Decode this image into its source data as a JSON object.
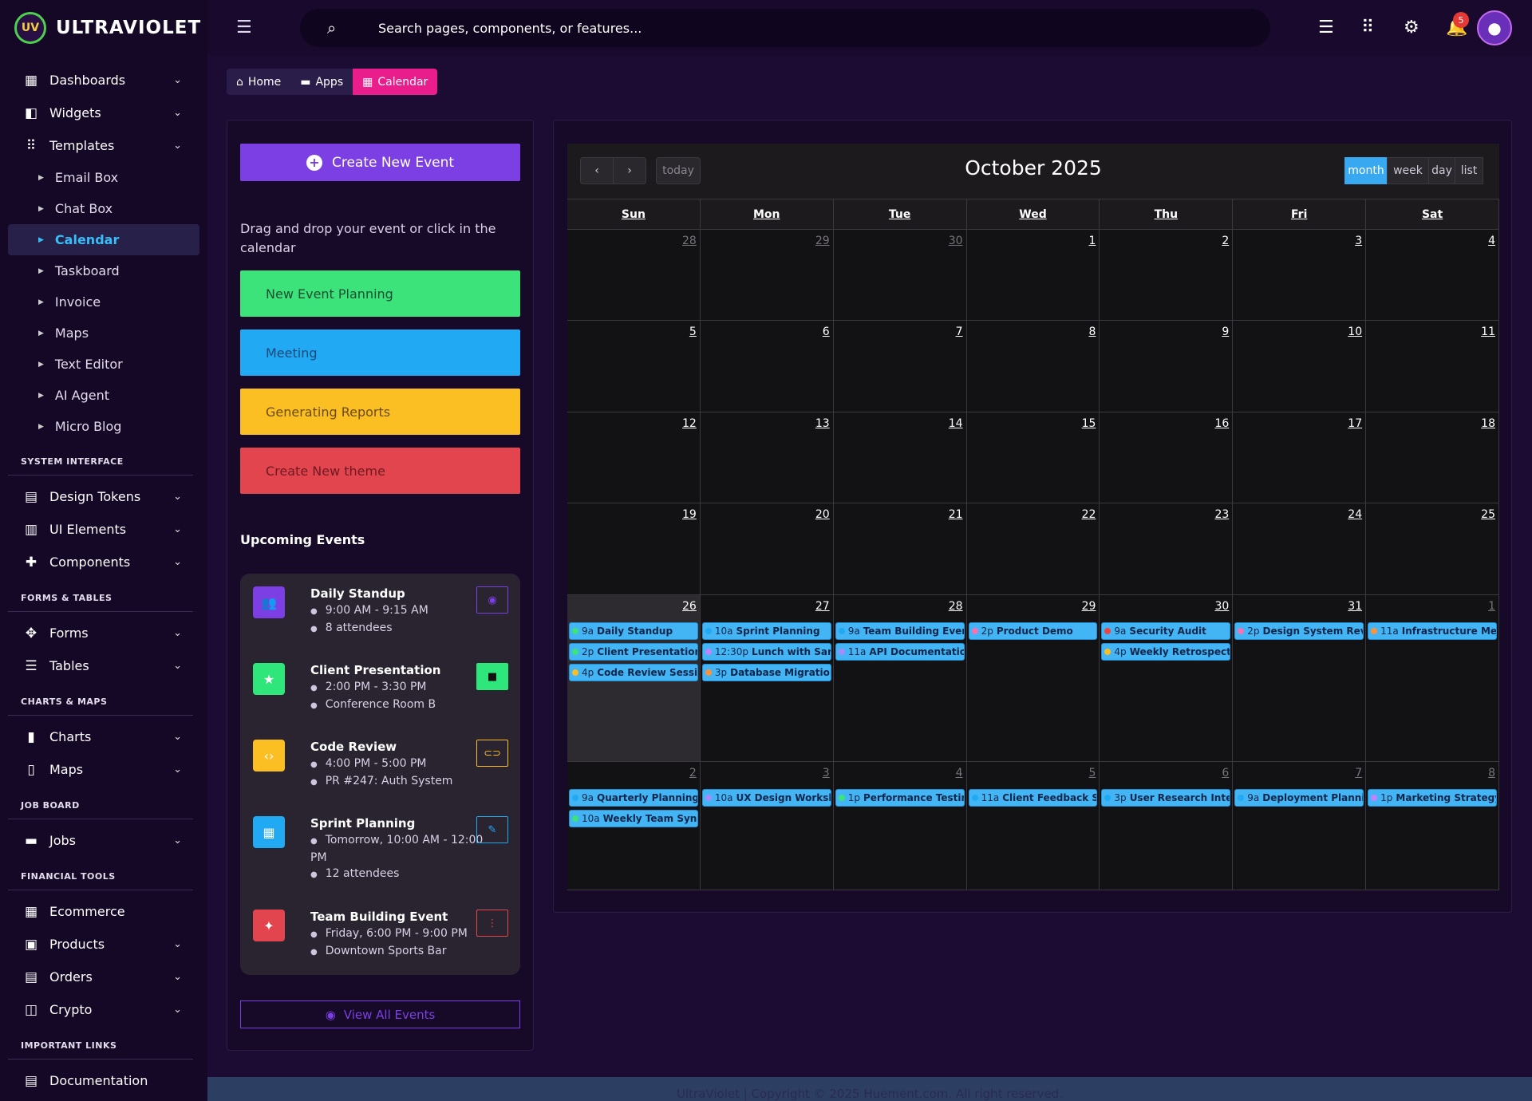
{
  "app": {
    "name": "ULTRAVIOLET",
    "logo_mark": "UV"
  },
  "sidebar": {
    "main": [
      {
        "label": "Dashboards",
        "icon": "dashboard-icon",
        "glyph": "▦",
        "chev": true
      },
      {
        "label": "Widgets",
        "icon": "widgets-icon",
        "glyph": "◧",
        "chev": true
      },
      {
        "label": "Templates",
        "icon": "templates-icon",
        "glyph": "⠿",
        "chev": true
      }
    ],
    "templates": [
      {
        "label": "Email Box"
      },
      {
        "label": "Chat Box"
      },
      {
        "label": "Calendar",
        "active": true
      },
      {
        "label": "Taskboard"
      },
      {
        "label": "Invoice"
      },
      {
        "label": "Maps"
      },
      {
        "label": "Text Editor"
      },
      {
        "label": "AI Agent"
      },
      {
        "label": "Micro Blog"
      }
    ],
    "section_system": "SYSTEM INTERFACE",
    "system": [
      {
        "label": "Design Tokens",
        "glyph": "▤"
      },
      {
        "label": "UI Elements",
        "glyph": "▥"
      },
      {
        "label": "Components",
        "glyph": "✚"
      }
    ],
    "section_forms": "FORMS & TABLES",
    "forms": [
      {
        "label": "Forms",
        "glyph": "✥"
      },
      {
        "label": "Tables",
        "glyph": "☰"
      }
    ],
    "section_charts": "CHARTS & MAPS",
    "charts": [
      {
        "label": "Charts",
        "glyph": "▮"
      },
      {
        "label": "Maps",
        "glyph": "▯"
      }
    ],
    "section_jobs": "JOB BOARD",
    "jobs": [
      {
        "label": "Jobs",
        "glyph": "▬"
      }
    ],
    "section_fin": "FINANCIAL TOOLS",
    "fin": [
      {
        "label": "Ecommerce",
        "glyph": "▦",
        "chev": false
      },
      {
        "label": "Products",
        "glyph": "▣",
        "chev": true
      },
      {
        "label": "Orders",
        "glyph": "▤",
        "chev": true
      },
      {
        "label": "Crypto",
        "glyph": "◫",
        "chev": true
      }
    ],
    "section_links": "IMPORTANT LINKS",
    "links": [
      {
        "label": "Documentation",
        "glyph": "▤"
      }
    ]
  },
  "header": {
    "search_placeholder": "Search pages, components, or features...",
    "notification_count": "5"
  },
  "breadcrumb": {
    "home": "Home",
    "apps": "Apps",
    "current": "Calendar"
  },
  "left": {
    "create_label": "Create New Event",
    "hint": "Drag and drop your event or click in the calendar",
    "external_events": [
      {
        "label": "New Event Planning",
        "bg": "#3be37a",
        "fg": "#1d4d33"
      },
      {
        "label": "Meeting",
        "bg": "#22a9f4",
        "fg": "#1b4a7a"
      },
      {
        "label": "Generating Reports",
        "bg": "#fbbf24",
        "fg": "#6a4b10"
      },
      {
        "label": "Create New theme",
        "bg": "#e2454e",
        "fg": "#6e1a22"
      }
    ],
    "upcoming_title": "Upcoming Events",
    "upcoming": [
      {
        "name": "Daily Standup",
        "time": "9:00 AM - 9:15 AM",
        "meta": "8 attendees",
        "meta_icon": "person-icon",
        "color": "#7b3fe4",
        "glyph": "👥",
        "action": "view-icon",
        "action_glyph": "◉",
        "action_style": "outline"
      },
      {
        "name": "Client Presentation",
        "time": "2:00 PM - 3:30 PM",
        "meta": "Conference Room B",
        "meta_icon": "location-icon",
        "color": "#2ee67a",
        "glyph": "★",
        "action": "video-icon",
        "action_glyph": "■",
        "action_style": "solid"
      },
      {
        "name": "Code Review",
        "time": "4:00 PM - 5:00 PM",
        "meta": "PR #247: Auth System",
        "meta_icon": "file-icon",
        "color": "#fbbf24",
        "glyph": "‹›",
        "action": "link-icon",
        "action_glyph": "⊂⊃",
        "action_style": "outline"
      },
      {
        "name": "Sprint Planning",
        "time": "Tomorrow, 10:00 AM - 12:00 PM",
        "meta": "12 attendees",
        "meta_icon": "person-icon",
        "color": "#22a9f4",
        "glyph": "▦",
        "action": "edit-icon",
        "action_glyph": "✎",
        "action_style": "outline"
      },
      {
        "name": "Team Building Event",
        "time": "Friday, 6:00 PM - 9:00 PM",
        "meta": "Downtown Sports Bar",
        "meta_icon": "location-icon",
        "color": "#e2454e",
        "glyph": "✦",
        "action": "more-icon",
        "action_glyph": "⋮",
        "action_style": "outline"
      }
    ],
    "view_all": "View All Events"
  },
  "calendar": {
    "title": "October 2025",
    "today": "today",
    "views": [
      "month",
      "week",
      "day",
      "list"
    ],
    "active_view": "month",
    "dow": [
      "Sun",
      "Mon",
      "Tue",
      "Wed",
      "Thu",
      "Fri",
      "Sat"
    ],
    "weeks": [
      [
        {
          "d": "28",
          "o": true
        },
        {
          "d": "29",
          "o": true
        },
        {
          "d": "30",
          "o": true
        },
        {
          "d": "1"
        },
        {
          "d": "2"
        },
        {
          "d": "3"
        },
        {
          "d": "4"
        }
      ],
      [
        {
          "d": "5"
        },
        {
          "d": "6"
        },
        {
          "d": "7"
        },
        {
          "d": "8"
        },
        {
          "d": "9"
        },
        {
          "d": "10"
        },
        {
          "d": "11"
        }
      ],
      [
        {
          "d": "12"
        },
        {
          "d": "13"
        },
        {
          "d": "14"
        },
        {
          "d": "15"
        },
        {
          "d": "16"
        },
        {
          "d": "17"
        },
        {
          "d": "18"
        }
      ],
      [
        {
          "d": "19"
        },
        {
          "d": "20"
        },
        {
          "d": "21"
        },
        {
          "d": "22"
        },
        {
          "d": "23"
        },
        {
          "d": "24"
        },
        {
          "d": "25"
        }
      ],
      [
        {
          "d": "26",
          "today": true,
          "events": [
            {
              "t": "9a",
              "n": "Daily Standup",
              "c": "#3be37a"
            },
            {
              "t": "2p",
              "n": "Client Presentation",
              "c": "#3be37a"
            },
            {
              "t": "4p",
              "n": "Code Review Session",
              "c": "#fbbf24"
            }
          ]
        },
        {
          "d": "27",
          "events": [
            {
              "t": "10a",
              "n": "Sprint Planning",
              "c": "#22a9f4"
            },
            {
              "t": "12:30p",
              "n": "Lunch with Sarah",
              "c": "#c084fc"
            },
            {
              "t": "3p",
              "n": "Database Migration",
              "c": "#fb923c"
            }
          ]
        },
        {
          "d": "28",
          "events": [
            {
              "t": "9a",
              "n": "Team Building Event",
              "c": "#22a9f4"
            },
            {
              "t": "11a",
              "n": "API Documentation Review",
              "c": "#a78bfa"
            }
          ]
        },
        {
          "d": "29",
          "events": [
            {
              "t": "2p",
              "n": "Product Demo",
              "c": "#f472b6"
            }
          ]
        },
        {
          "d": "30",
          "events": [
            {
              "t": "9a",
              "n": "Security Audit",
              "c": "#ef4444"
            },
            {
              "t": "4p",
              "n": "Weekly Retrospective",
              "c": "#fbbf24"
            }
          ]
        },
        {
          "d": "31",
          "events": [
            {
              "t": "2p",
              "n": "Design System Review",
              "c": "#f472b6"
            }
          ]
        },
        {
          "d": "1",
          "o": true,
          "events": [
            {
              "t": "11a",
              "n": "Infrastructure Meeting",
              "c": "#fb923c"
            }
          ]
        }
      ],
      [
        {
          "d": "2",
          "o": true,
          "events": [
            {
              "t": "9a",
              "n": "Quarterly Planning",
              "c": "#22a9f4"
            },
            {
              "t": "10a",
              "n": "Weekly Team Sync",
              "c": "#3be37a"
            }
          ]
        },
        {
          "d": "3",
          "o": true,
          "events": [
            {
              "t": "10a",
              "n": "UX Design Workshop",
              "c": "#a78bfa"
            }
          ]
        },
        {
          "d": "4",
          "o": true,
          "events": [
            {
              "t": "1p",
              "n": "Performance Testing",
              "c": "#3be37a"
            }
          ]
        },
        {
          "d": "5",
          "o": true,
          "events": [
            {
              "t": "11a",
              "n": "Client Feedback Session",
              "c": "#22a9f4"
            }
          ]
        },
        {
          "d": "6",
          "o": true,
          "events": [
            {
              "t": "3p",
              "n": "User Research Interview",
              "c": "#22a9f4"
            }
          ]
        },
        {
          "d": "7",
          "o": true,
          "events": [
            {
              "t": "9a",
              "n": "Deployment Planning",
              "c": "#22a9f4"
            }
          ]
        },
        {
          "d": "8",
          "o": true,
          "events": [
            {
              "t": "1p",
              "n": "Marketing Strategy Session",
              "c": "#c084fc"
            }
          ]
        }
      ]
    ]
  },
  "footer": {
    "text": "UltraViolet | Copyright © 2025 Huement.com. All right reserved."
  }
}
